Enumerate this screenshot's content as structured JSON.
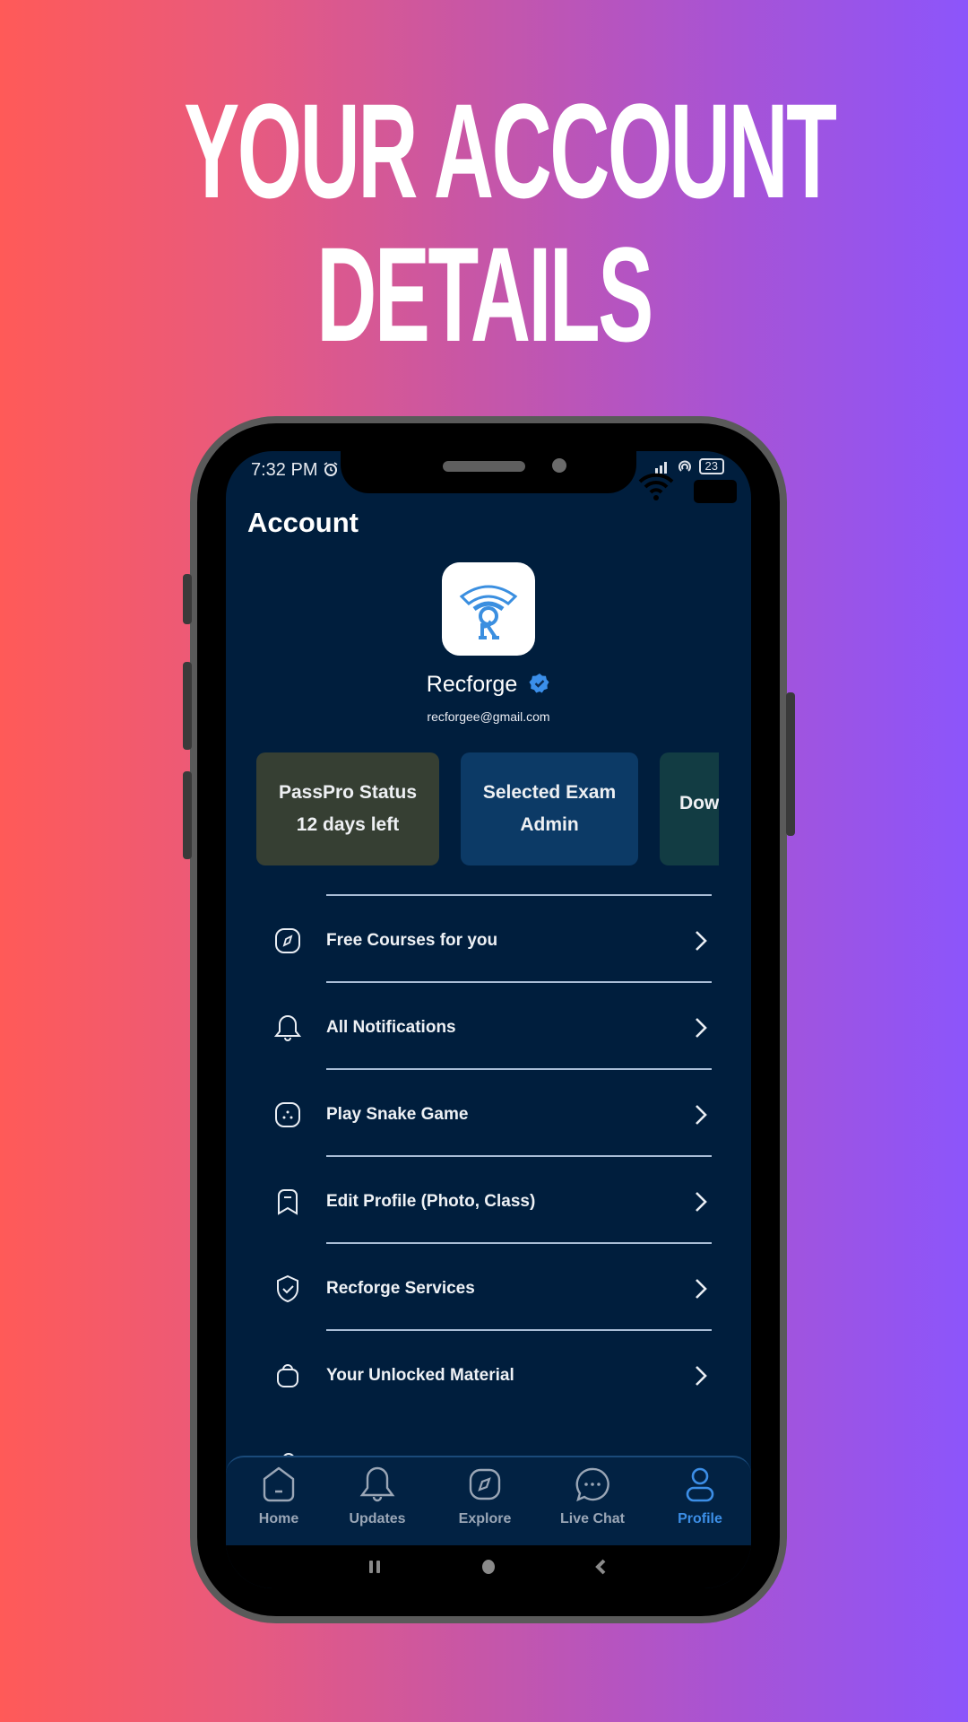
{
  "promo": {
    "headline_line1": "YOUR ACCOUNT",
    "headline_line2": "DETAILS"
  },
  "status_bar": {
    "time": "7:32 PM",
    "battery_level": "23",
    "icons": [
      "alarm-icon",
      "signal-icon",
      "hotspot-icon",
      "wifi-icon",
      "battery-icon"
    ]
  },
  "header": {
    "title": "Account"
  },
  "profile": {
    "name": "Recforge",
    "email": "recforgee@gmail.com",
    "verified": true,
    "verified_color": "#3b8fea"
  },
  "cards": [
    {
      "title": "PassPro Status",
      "value": "12 days left",
      "color": "#363f33"
    },
    {
      "title": "Selected Exam",
      "value": "Admin",
      "color": "#0c3a66"
    },
    {
      "title": "Dow",
      "value": "",
      "color": "#123c43"
    }
  ],
  "menu": [
    {
      "label": "Free Courses for you",
      "icon": "compass-icon"
    },
    {
      "label": "All Notifications",
      "icon": "bell-icon"
    },
    {
      "label": "Play Snake Game",
      "icon": "game-icon"
    },
    {
      "label": "Edit Profile (Photo, Class)",
      "icon": "bookmark-icon"
    },
    {
      "label": "Recforge Services",
      "icon": "shield-check-icon"
    },
    {
      "label": "Your Unlocked Material",
      "icon": "bag-icon"
    }
  ],
  "bottom_nav": {
    "active": "Profile",
    "active_color": "#3c8ee6",
    "items": [
      {
        "label": "Home",
        "icon": "home-icon"
      },
      {
        "label": "Updates",
        "icon": "bell-icon"
      },
      {
        "label": "Explore",
        "icon": "compass-icon"
      },
      {
        "label": "Live Chat",
        "icon": "chat-icon"
      },
      {
        "label": "Profile",
        "icon": "user-icon"
      }
    ]
  },
  "system_nav": [
    "recents-button",
    "home-button",
    "back-button"
  ]
}
